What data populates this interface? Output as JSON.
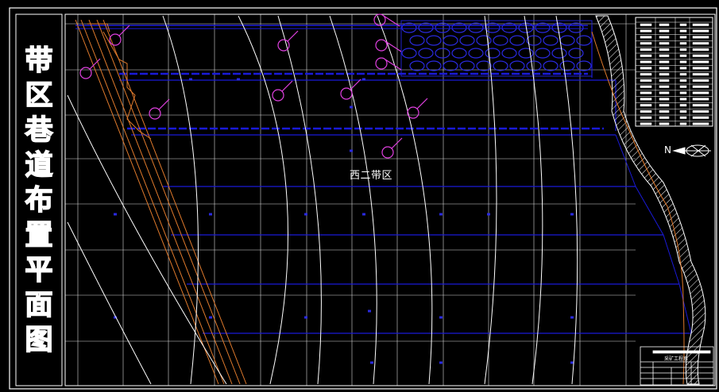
{
  "drawing": {
    "title_chars": [
      "带",
      "区",
      "巷",
      "道",
      "布",
      "置",
      "平",
      "面",
      "图"
    ],
    "region_label": "西二带区",
    "north_label": "N",
    "title_block_caption": "采矿工程系"
  },
  "colors": {
    "background": "#000000",
    "frame": "#ffffff",
    "grid": "#ffffff",
    "roadway_blue": "#1a1ad8",
    "goaf_blue": "#2222cc",
    "fault_orange": "#e07a2c",
    "callout_magenta": "#e040e0",
    "contour_white": "#ffffff"
  },
  "icons": [
    "north-arrow-icon",
    "legend-table-icon",
    "title-block-icon",
    "hatched-boundary-icon"
  ]
}
